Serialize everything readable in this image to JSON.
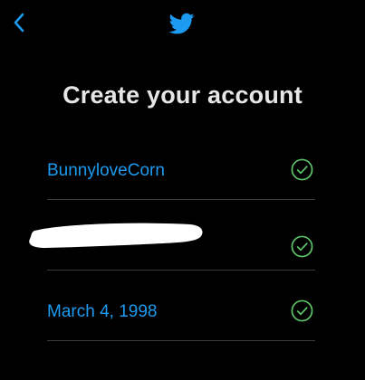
{
  "header": {
    "back_icon": "chevron-left-icon",
    "logo_icon": "twitter-bird-icon"
  },
  "page": {
    "title": "Create your account"
  },
  "form": {
    "name": {
      "value": "BunnyloveCorn",
      "valid": true
    },
    "contact": {
      "value": "",
      "redacted": true,
      "valid": true
    },
    "birthdate": {
      "value": "March 4, 1998",
      "valid": true
    }
  },
  "colors": {
    "background": "#000000",
    "accent": "#1d9bf0",
    "title": "#e6e6e6",
    "valid": "#5ec46a",
    "divider": "#3a3a3a"
  }
}
